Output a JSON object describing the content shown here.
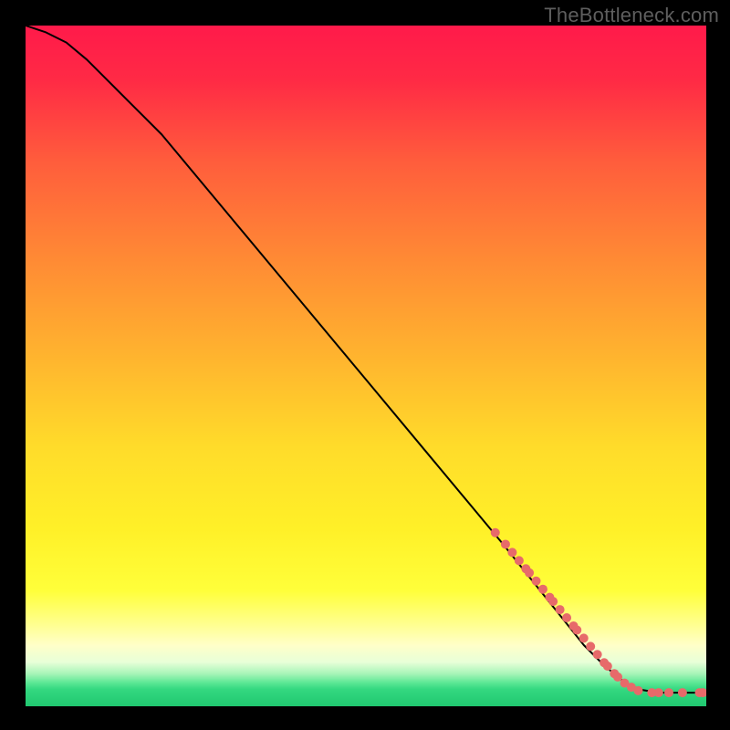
{
  "attribution": "TheBottleneck.com",
  "chart_data": {
    "type": "line",
    "title": "",
    "xlabel": "",
    "ylabel": "",
    "xlim": [
      0,
      100
    ],
    "ylim": [
      0,
      100
    ],
    "grid": false,
    "legend": false,
    "background_gradient": {
      "description": "vertical gradient from red at top through orange/yellow to light-yellow then a thin green band near the bottom",
      "stops": [
        {
          "pct": 0,
          "color": "#FF1A4A"
        },
        {
          "pct": 8,
          "color": "#FF2A45"
        },
        {
          "pct": 20,
          "color": "#FF5D3C"
        },
        {
          "pct": 35,
          "color": "#FF8C34"
        },
        {
          "pct": 50,
          "color": "#FFB82E"
        },
        {
          "pct": 62,
          "color": "#FFDC2A"
        },
        {
          "pct": 74,
          "color": "#FFF028"
        },
        {
          "pct": 83,
          "color": "#FFFF3A"
        },
        {
          "pct": 88,
          "color": "#FFFF90"
        },
        {
          "pct": 91,
          "color": "#FFFFC8"
        },
        {
          "pct": 93.5,
          "color": "#E8FFD8"
        },
        {
          "pct": 95.2,
          "color": "#A8F5B8"
        },
        {
          "pct": 96.5,
          "color": "#5EE896"
        },
        {
          "pct": 97.5,
          "color": "#34D880"
        },
        {
          "pct": 100,
          "color": "#20C870"
        }
      ]
    },
    "series": [
      {
        "name": "bottleneck-curve",
        "type": "line",
        "color": "#000000",
        "x": [
          0,
          3,
          6,
          9,
          12,
          16,
          20,
          30,
          40,
          50,
          60,
          70,
          78,
          82,
          85,
          88,
          90,
          93,
          96,
          98,
          100
        ],
        "y": [
          100,
          99,
          97.5,
          95,
          92,
          88,
          84,
          72,
          60,
          48,
          36,
          24,
          14,
          9,
          6,
          3.5,
          2.5,
          2,
          2,
          2,
          2
        ]
      },
      {
        "name": "datapoints",
        "type": "scatter",
        "color": "#E76A6A",
        "marker_size_px": 10,
        "x": [
          69,
          70.5,
          71.5,
          72.5,
          73.5,
          74,
          75,
          76,
          77,
          77.5,
          78.5,
          79.5,
          80.5,
          81,
          82,
          83,
          84,
          85,
          85.5,
          86.5,
          87,
          88,
          89,
          90,
          92,
          93,
          94.5,
          96.5,
          99,
          99.5
        ],
        "y": [
          25.5,
          23.8,
          22.6,
          21.4,
          20.2,
          19.6,
          18.4,
          17.2,
          16.0,
          15.4,
          14.2,
          13.0,
          11.8,
          11.2,
          10.0,
          8.8,
          7.6,
          6.4,
          5.9,
          4.8,
          4.3,
          3.4,
          2.8,
          2.3,
          2.0,
          2.0,
          2.0,
          2.0,
          2.0,
          2.0
        ]
      }
    ]
  }
}
